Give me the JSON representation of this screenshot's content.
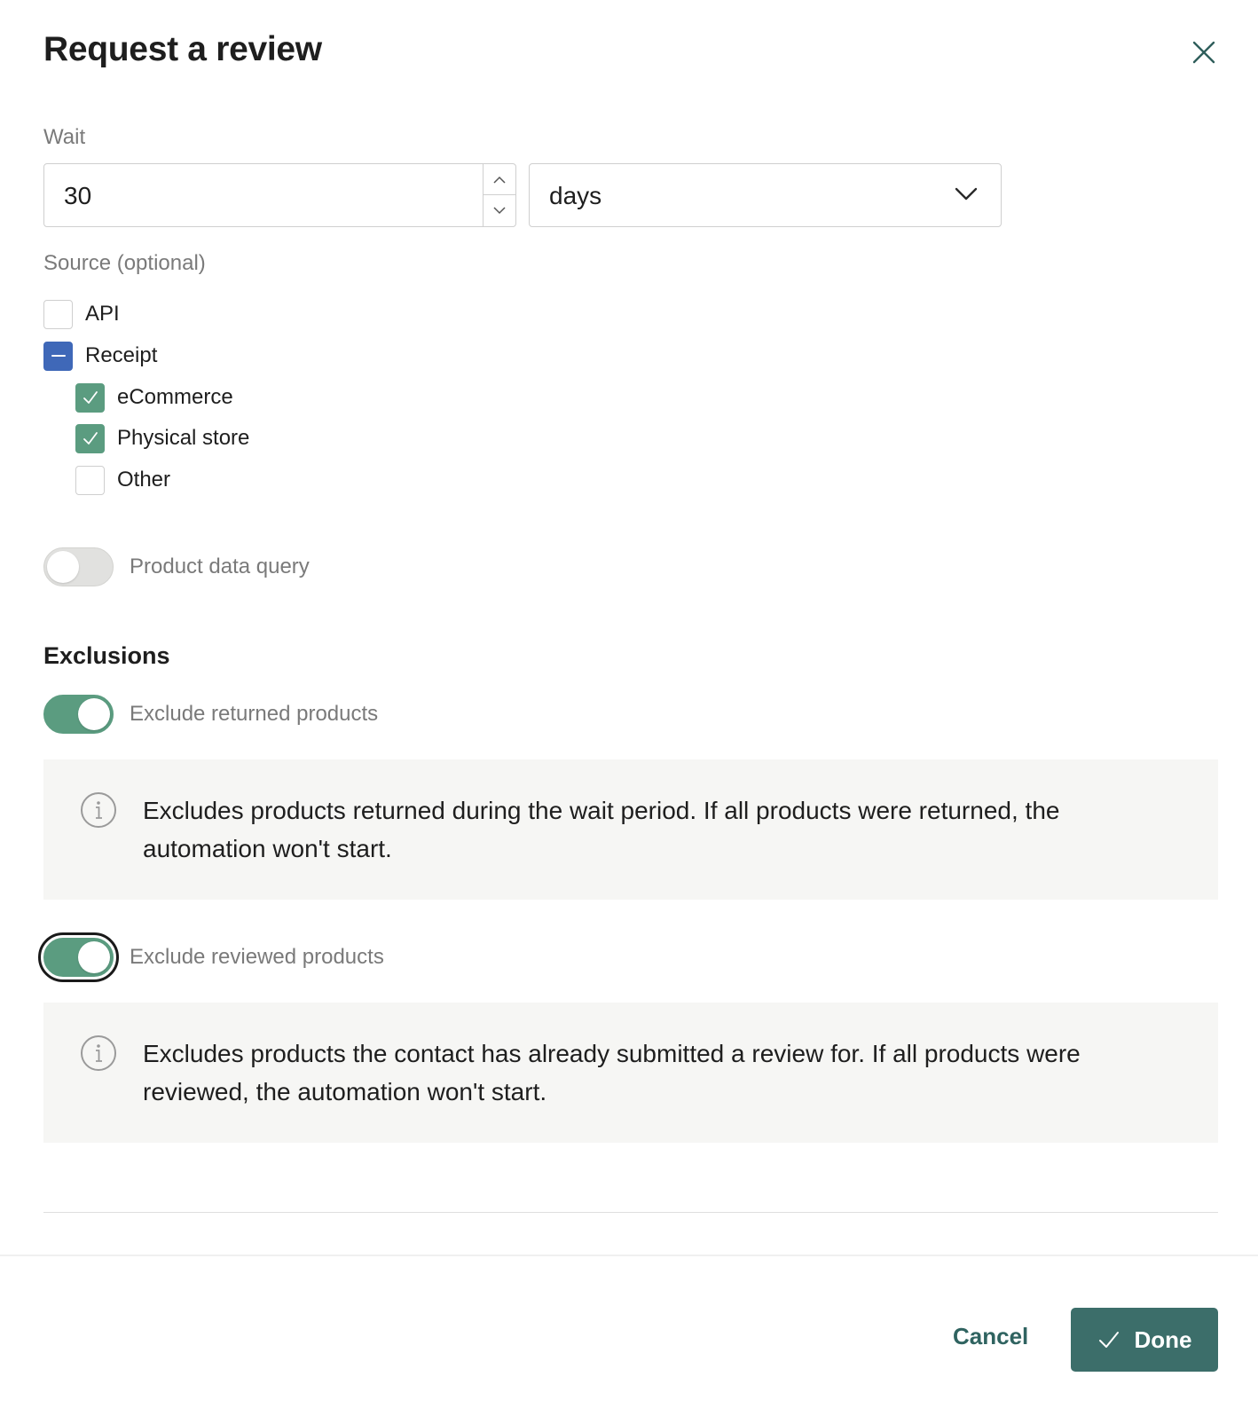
{
  "dialog": {
    "title": "Request a review"
  },
  "wait": {
    "label": "Wait",
    "amount": "30",
    "unit": "days"
  },
  "source": {
    "label": "Source (optional)",
    "options": [
      {
        "label": "API",
        "state": "unchecked"
      },
      {
        "label": "Receipt",
        "state": "indeterminate"
      },
      {
        "label": "eCommerce",
        "state": "checked"
      },
      {
        "label": "Physical store",
        "state": "checked"
      },
      {
        "label": "Other",
        "state": "unchecked"
      }
    ]
  },
  "product_query": {
    "label": "Product data query",
    "on": false
  },
  "exclusions": {
    "title": "Exclusions",
    "returned": {
      "label": "Exclude returned products",
      "on": true,
      "info": "Excludes products returned during the wait period. If all products were returned, the automation won't start."
    },
    "reviewed": {
      "label": "Exclude reviewed products",
      "on": true,
      "focused": true,
      "info": "Excludes products the contact has already submitted a review for. If all products were reviewed, the automation won't start."
    }
  },
  "footer": {
    "cancel_label": "Cancel",
    "done_label": "Done"
  },
  "colors": {
    "accent_green": "#5b9c80",
    "indeterminate_blue": "#3f68b8",
    "primary_button": "#3c6e6a",
    "link": "#2f6360"
  },
  "icons": {
    "close": "close-icon",
    "info": "info-icon",
    "check": "check-icon",
    "chevron": "chevron-down-icon"
  }
}
